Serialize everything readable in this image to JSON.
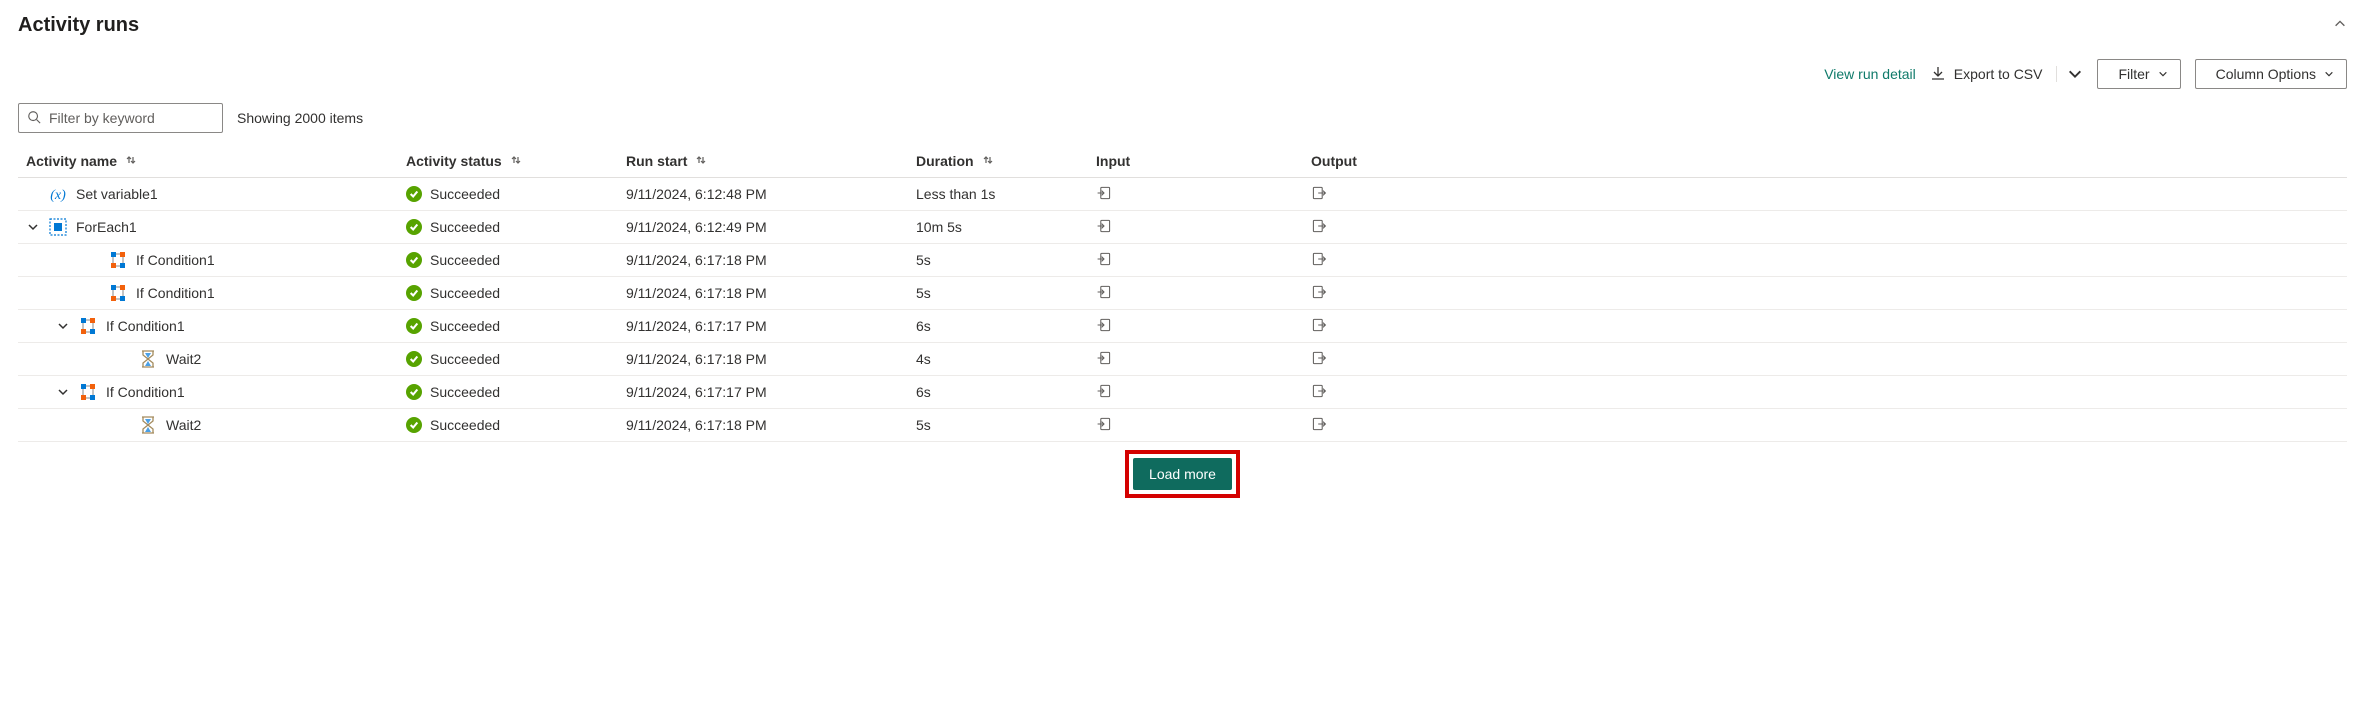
{
  "title": "Activity runs",
  "toolbar": {
    "view_run_detail": "View run detail",
    "export_csv": "Export to CSV",
    "filter": "Filter",
    "column_options": "Column Options"
  },
  "search": {
    "placeholder": "Filter by keyword"
  },
  "item_count_text": "Showing 2000 items",
  "columns": {
    "activity_name": "Activity name",
    "activity_status": "Activity status",
    "run_start": "Run start",
    "duration": "Duration",
    "input": "Input",
    "output": "Output"
  },
  "rows": [
    {
      "indent": 0,
      "expander": "",
      "icon": "variable",
      "name": "Set variable1",
      "status": "Succeeded",
      "start": "9/11/2024, 6:12:48 PM",
      "duration": "Less than 1s"
    },
    {
      "indent": 0,
      "expander": "down",
      "icon": "foreach",
      "name": "ForEach1",
      "status": "Succeeded",
      "start": "9/11/2024, 6:12:49 PM",
      "duration": "10m 5s"
    },
    {
      "indent": 2,
      "expander": "",
      "icon": "ifcond",
      "name": "If Condition1",
      "status": "Succeeded",
      "start": "9/11/2024, 6:17:18 PM",
      "duration": "5s"
    },
    {
      "indent": 2,
      "expander": "",
      "icon": "ifcond",
      "name": "If Condition1",
      "status": "Succeeded",
      "start": "9/11/2024, 6:17:18 PM",
      "duration": "5s"
    },
    {
      "indent": 1,
      "expander": "down",
      "icon": "ifcond",
      "name": "If Condition1",
      "status": "Succeeded",
      "start": "9/11/2024, 6:17:17 PM",
      "duration": "6s"
    },
    {
      "indent": 3,
      "expander": "",
      "icon": "wait",
      "name": "Wait2",
      "status": "Succeeded",
      "start": "9/11/2024, 6:17:18 PM",
      "duration": "4s"
    },
    {
      "indent": 1,
      "expander": "down",
      "icon": "ifcond",
      "name": "If Condition1",
      "status": "Succeeded",
      "start": "9/11/2024, 6:17:17 PM",
      "duration": "6s"
    },
    {
      "indent": 3,
      "expander": "",
      "icon": "wait",
      "name": "Wait2",
      "status": "Succeeded",
      "start": "9/11/2024, 6:17:18 PM",
      "duration": "5s"
    }
  ],
  "load_more": "Load more"
}
